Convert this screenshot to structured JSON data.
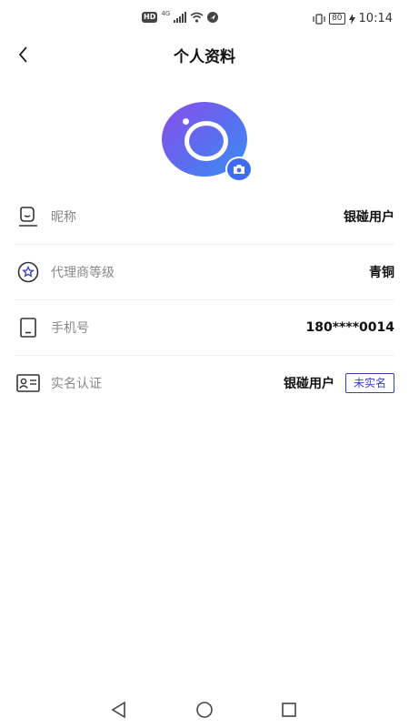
{
  "status_bar": {
    "left_badge": "HD",
    "network": "4G",
    "battery": "80",
    "time": "10:14"
  },
  "header": {
    "title": "个人资料"
  },
  "profile": {
    "rows": [
      {
        "label": "昵称",
        "value": "银碰用户",
        "icon": "face-icon"
      },
      {
        "label": "代理商等级",
        "value": "青铜",
        "icon": "star-badge-icon"
      },
      {
        "label": "手机号",
        "value": "180****0014",
        "icon": "phone-icon"
      },
      {
        "label": "实名认证",
        "value": "银碰用户",
        "badge": "未实名",
        "icon": "id-card-icon"
      }
    ]
  },
  "colors": {
    "accent": "#3a3fbf",
    "avatar_start": "#8a4de9",
    "avatar_end": "#3a8ff2"
  }
}
